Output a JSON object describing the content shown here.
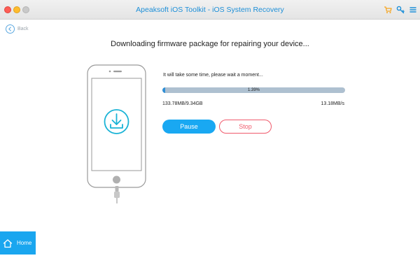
{
  "window": {
    "title": "Apeaksoft iOS Toolkit - iOS System Recovery"
  },
  "toolbar": {
    "icons": [
      "cart-icon",
      "key-icon",
      "menu-icon"
    ]
  },
  "nav": {
    "back_label": "Back",
    "home_label": "Home"
  },
  "main": {
    "heading": "Downloading firmware package for repairing your device...",
    "wait_text": "It will take some time, please wait a moment...",
    "progress_percent": 1.39,
    "progress_label": "1.39%",
    "downloaded_size": "133.78MB/9.34GB",
    "download_speed": "13.18MB/s",
    "pause_label": "Pause",
    "stop_label": "Stop"
  },
  "colors": {
    "accent": "#19a8f2",
    "title_text": "#1d8fd8",
    "stop": "#f05a6c",
    "progress_track": "#aec0d0",
    "progress_fill": "#2f8fd6"
  }
}
